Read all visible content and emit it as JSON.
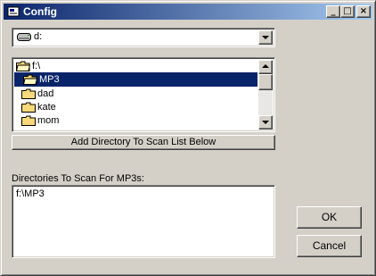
{
  "window": {
    "title": "Config",
    "minimize": "_",
    "maximize": "□",
    "close": "×"
  },
  "drive": {
    "selected": "d:"
  },
  "directories": {
    "items": [
      "f:\\",
      "MP3",
      "dad",
      "kate",
      "mom"
    ],
    "selected": "MP3"
  },
  "buttons": {
    "add": "Add Directory To Scan List Below",
    "ok": "OK",
    "cancel": "Cancel"
  },
  "scan_list": {
    "label": "Directories To Scan For MP3s:",
    "items": [
      "f:\\MP3"
    ]
  },
  "colors": {
    "face": "#d4d0c8",
    "selection": "#0a246a",
    "title_start": "#0a246a",
    "title_end": "#a6caf0",
    "folder": "#f8d878"
  }
}
